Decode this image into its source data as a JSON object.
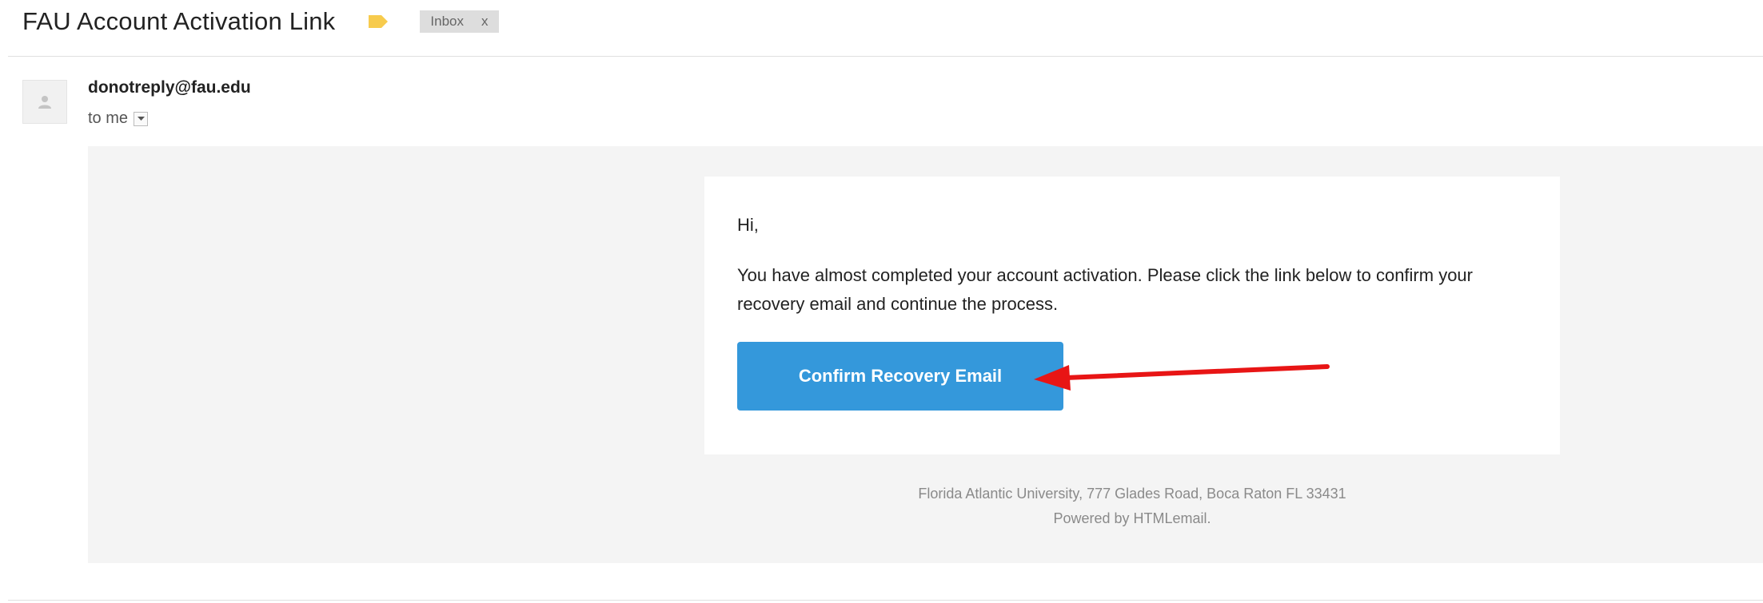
{
  "thread": {
    "subject": "FAU Account Activation Link",
    "label_chip": "Inbox",
    "label_chip_close": "x",
    "label_color": "#f7cb4d"
  },
  "message": {
    "sender": "donotreply@fau.edu",
    "recipient": "to me"
  },
  "email": {
    "greeting": "Hi,",
    "body": "You have almost completed your account activation. Please click the link below to confirm your recovery email and continue the process.",
    "button_label": "Confirm Recovery Email",
    "button_color": "#3498db",
    "footer_address": "Florida Atlantic University, 777 Glades Road, Boca Raton FL 33431",
    "footer_powered": "Powered by HTMLemail."
  },
  "annotation": {
    "arrow_color": "#e81515"
  }
}
